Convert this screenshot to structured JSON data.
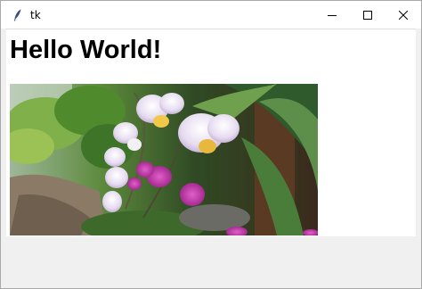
{
  "window": {
    "title": "tk",
    "controls": {
      "minimize": "minimize",
      "maximize": "maximize",
      "close": "close"
    }
  },
  "main": {
    "heading": "Hello World!",
    "image": {
      "subject": "orchid-flowers-photo"
    }
  },
  "colors": {
    "titlebar_bg": "#ffffff",
    "client_bg": "#f0f0f0",
    "content_bg": "#ffffff",
    "heading_text": "#000000"
  }
}
